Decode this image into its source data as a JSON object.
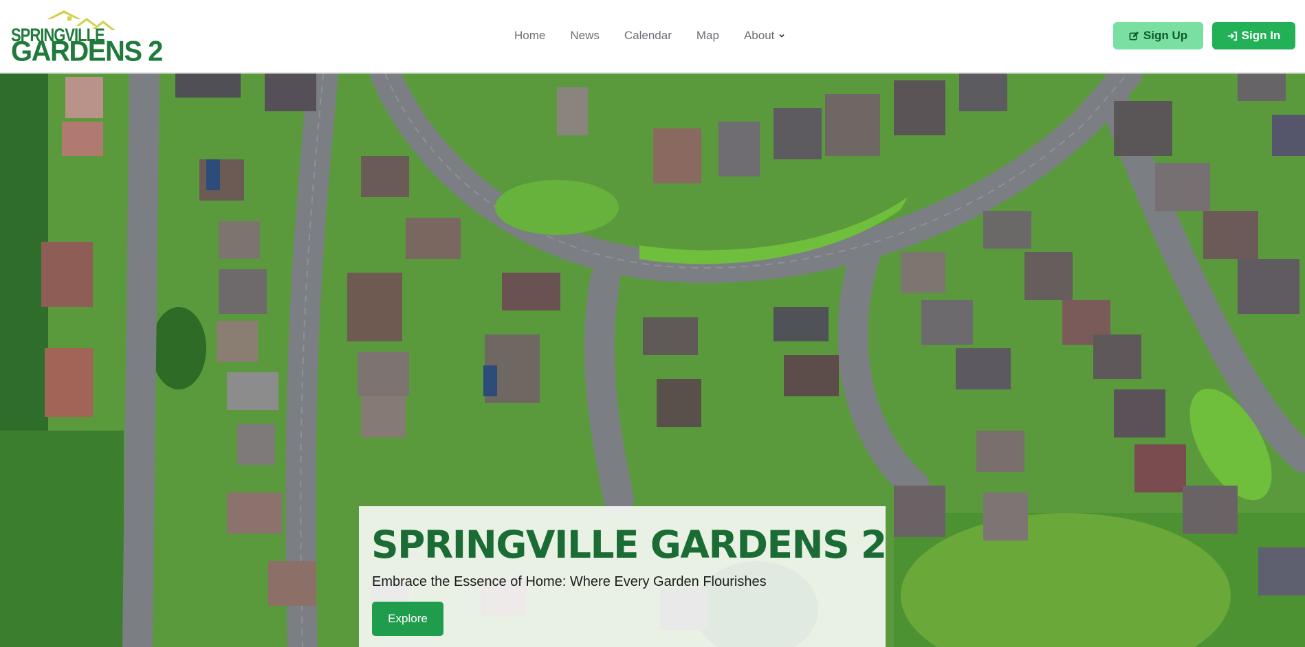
{
  "brand": {
    "logo_line1": "SPRINGVILLE",
    "logo_line2": "GARDENS 2",
    "primary_color": "#1f7a3b",
    "accent_color": "#cfd24a"
  },
  "nav": {
    "items": [
      {
        "label": "Home"
      },
      {
        "label": "News"
      },
      {
        "label": "Calendar"
      },
      {
        "label": "Map"
      },
      {
        "label": "About",
        "has_dropdown": true
      }
    ]
  },
  "auth": {
    "signup_label": "Sign Up",
    "signup_icon": "edit-icon",
    "signin_label": "Sign In",
    "signin_icon": "login-icon",
    "signup_color": "#79e0a1",
    "signin_color": "#23b158"
  },
  "hero": {
    "title": "SPRINGVILLE GARDENS 2",
    "subtitle": "Embrace the Essence of Home: Where Every Garden Flourishes",
    "cta_label": "Explore",
    "cta_color": "#1f9d4d"
  }
}
